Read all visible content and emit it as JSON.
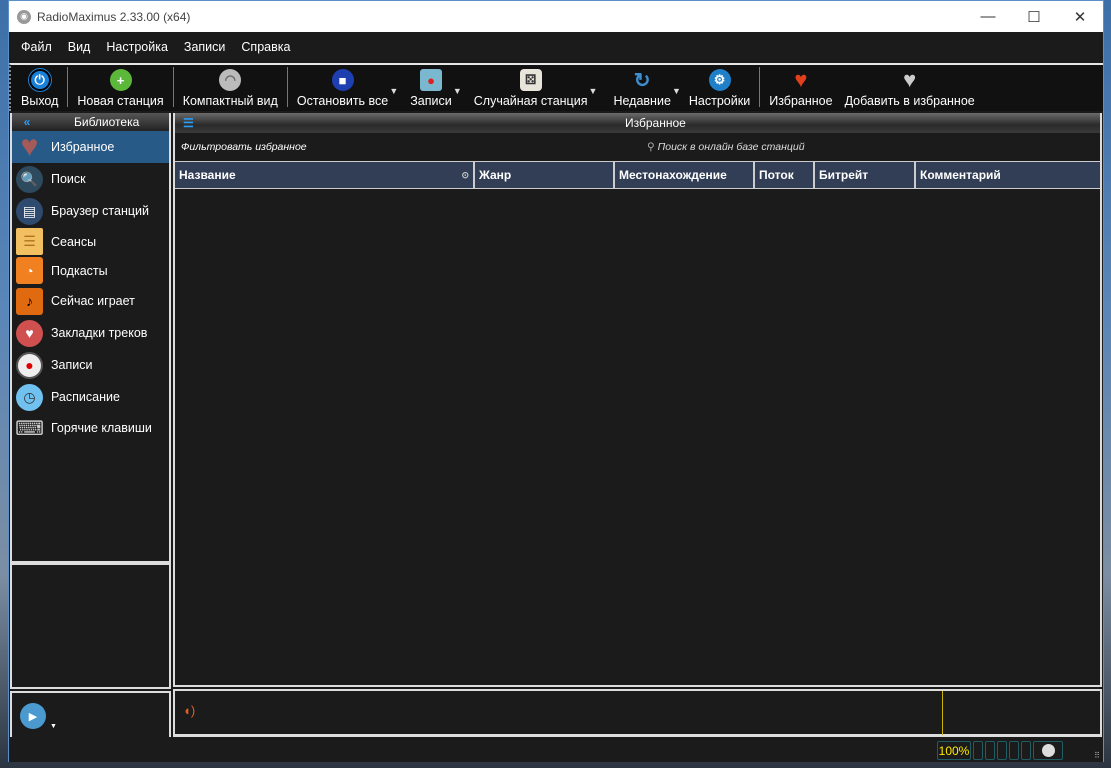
{
  "window": {
    "title": "RadioMaximus 2.33.00 (x64)"
  },
  "menu": [
    "Файл",
    "Вид",
    "Настройка",
    "Записи",
    "Справка"
  ],
  "toolbar": [
    {
      "label": "Выход",
      "icon": "power-icon",
      "color": "#1a7fd6"
    },
    {
      "label": "Новая станция",
      "icon": "plus-icon",
      "color": "#5cb83a"
    },
    {
      "label": "Компактный вид",
      "icon": "radio-waves-icon",
      "color": "#bbbbbb"
    },
    {
      "label": "Остановить все",
      "icon": "stop-icon",
      "color": "#1d3fb0"
    },
    {
      "label": "Записи",
      "icon": "record-icon",
      "color": "#7ab8d0"
    },
    {
      "label": "Случайная станция",
      "icon": "dice-icon",
      "color": "#e8e4da"
    },
    {
      "label": "Недавние",
      "icon": "refresh-icon",
      "color": "#3d8fd1"
    },
    {
      "label": "Настройки",
      "icon": "gear-icon",
      "color": "#1f7fc8"
    },
    {
      "label": "Избранное",
      "icon": "heart-icon",
      "color": "#e0401c"
    },
    {
      "label": "Добавить в избранное",
      "icon": "heart-plus-icon",
      "color": "#cccccc"
    }
  ],
  "library": {
    "title": "Библиотека",
    "items": [
      {
        "label": "Избранное",
        "icon": "heart-icon",
        "color": "#a55a5a"
      },
      {
        "label": "Поиск",
        "icon": "search-icon",
        "color": "#2e4a5e"
      },
      {
        "label": "Браузер станций",
        "icon": "browser-icon",
        "color": "#2e4a6e"
      },
      {
        "label": "Сеансы",
        "icon": "sessions-icon",
        "color": "#f2c060"
      },
      {
        "label": "Подкасты",
        "icon": "rss-icon",
        "color": "#f08020"
      },
      {
        "label": "Сейчас играет",
        "icon": "music-note-icon",
        "color": "#e06a10"
      },
      {
        "label": "Закладки треков",
        "icon": "bookmark-heart-icon",
        "color": "#d05050"
      },
      {
        "label": "Записи",
        "icon": "record-icon",
        "color": "#eeeeee"
      },
      {
        "label": "Расписание",
        "icon": "clock-icon",
        "color": "#70c0f0"
      },
      {
        "label": "Горячие клавиши",
        "icon": "keyboard-icon",
        "color": "#cccccc"
      }
    ]
  },
  "main": {
    "title": "Избранное",
    "filter_placeholder": "Фильтровать избранное",
    "search_label": "Поиск в онлайн базе станций",
    "columns": [
      "Название",
      "Жанр",
      "Местонахождение",
      "Поток",
      "Битрейт",
      "Комментарий"
    ]
  },
  "status": {
    "volume": "100%"
  }
}
